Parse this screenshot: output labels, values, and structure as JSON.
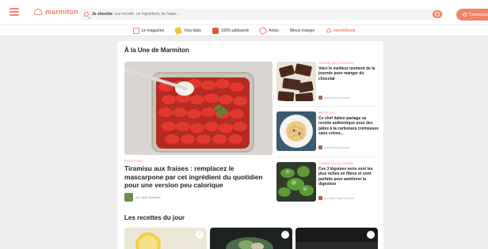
{
  "header": {
    "logo_text": "marmiton",
    "search_prefix": "Je cherche",
    "search_placeholder": "une recette, un ingrédient, de l'aide...",
    "connect_label": "Connexion"
  },
  "nav": {
    "items": [
      {
        "label": "Le magazine",
        "icon": "magazine-icon"
      },
      {
        "label": "Viva Italia",
        "icon": "pasta-icon"
      },
      {
        "label": "100% pâtisserie",
        "icon": "cake-icon"
      },
      {
        "label": "Actus",
        "icon": "megaphone-icon"
      },
      {
        "label": "Mieux manger",
        "icon": ""
      },
      {
        "label": "marmikiosk",
        "icon": "kiosk-icon"
      }
    ]
  },
  "main": {
    "section_title": "À la Une de Marmiton",
    "hero": {
      "category": "Recettes",
      "title": "Tiramisu aux fraises : remplacez le mascarpone par cet ingrédient du quotidien pour une version peu calorique",
      "author": "par Jean Ramène"
    },
    "side_items": [
      {
        "category": "Cuisine du quotidien",
        "title": "Voici le meilleur moment de la journée pour manger du chocolat",
        "author": "par Andréa Lemercier"
      },
      {
        "category": "Recettes",
        "title": "Ce chef italien partage sa recette authentique pour des pâtes à la carbonara crémeuses sans crème...",
        "author": "par Andréa Lemercier"
      },
      {
        "category": "Cuisine du quotidien",
        "title": "Ces 3 légumes verts sont les plus riches en fibres et sont parfaits pour améliorer la digestion",
        "author": "par Marie Angel Annunzio"
      }
    ],
    "recipes_title": "Les recettes du jour"
  },
  "colors": {
    "accent": "#f2836b",
    "background": "#eeeeee"
  }
}
